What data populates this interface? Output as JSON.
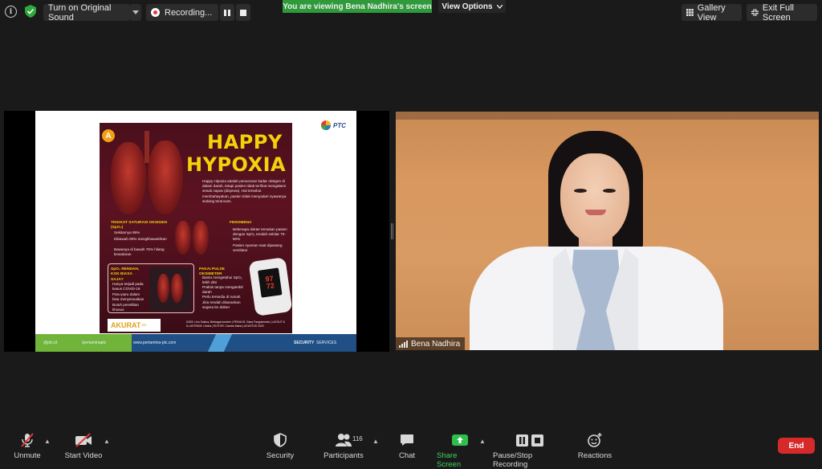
{
  "top_bar": {
    "info_icon": "info-icon",
    "security_icon": "shield-check-icon",
    "original_sound_label": "Turn on Original Sound",
    "recording_label": "Recording...",
    "banner_text": "You are viewing Bena Nadhira's screen",
    "view_options_label": "View Options",
    "gallery_view_label": "Gallery View",
    "exit_fullscreen_label": "Exit Full Screen"
  },
  "shared_screen": {
    "logo_text": "PTC",
    "poster": {
      "badge": "A",
      "title_line1": "HAPPY",
      "title_line2": "HYPOXIA",
      "intro": "Happy Hipoxia adalah penurunan kadar oksigen di dalam darah, tetapi pasien tidak terlihat mengalami sesak napas (dispnea). Hal tersebut membahayakan, pasien tidak menyadari nyawanya sedang terancam.",
      "sat_head": "TINGKAT SATURASI OKSIGEN (SpO₂)",
      "sat_items": [
        "Sekitarnya 95%",
        "Dibawah 90% mengkhawatirkan",
        "Bawanya di bawah 75% hilang kesadaran"
      ],
      "fen_head": "FENOMENA",
      "fen_items": [
        "Beberapa dokter temukan pasien dengan SpO₂ rendah sekitar 70-50%",
        "Pasien nyaman saat dipasang ventilator"
      ],
      "spo_head": "SpO₂ RENDAH, KOK BIASA SAJA?",
      "spo_items": [
        "Hanya terjadi pada kasus COVID-19",
        "Paru-paru dalam bisa menyesuaikan",
        "Butuh penelitian khusus"
      ],
      "oxi_head": "PAKAI PULSE OKSIMETER",
      "oxi_items": [
        "Bantu mengetahui SpO₂ lebih dini",
        "Praktis tanpa mengambil darah",
        "Perlu tersedia di rumah",
        "Jika rendah disarankan segera ke dokter"
      ],
      "oximeter_top": "97",
      "oximeter_bottom": "72",
      "brand": "AKURAT",
      "brand_suffix": ".co",
      "credits": "DATA: Unu Sukma, Berbagai sumber | PENULIS: Gany Fauguimenta | LAYOUT & ILLUSTRASI: Cindra | EDITOR: Candra Mana | AGUSTUS 2020"
    },
    "footer": {
      "instagram": "@ptc.id",
      "facebook": "/pertaminaptc",
      "website": "www.pertamina-ptc.com",
      "security_text": "SECURITY",
      "services_text": "SERVICES"
    }
  },
  "camera": {
    "participant_name": "Bena Nadhira"
  },
  "toolbar": {
    "unmute": "Unmute",
    "start_video": "Start Video",
    "security": "Security",
    "participants": "Participants",
    "participants_count": "116",
    "chat": "Chat",
    "share_screen": "Share Screen",
    "pause_stop_recording": "Pause/Stop Recording",
    "reactions": "Reactions",
    "end": "End"
  },
  "colors": {
    "banner_green": "#2e9a3a",
    "share_green": "#2fbf4a",
    "end_red": "#d6292a",
    "muted_red": "#e0393a"
  }
}
